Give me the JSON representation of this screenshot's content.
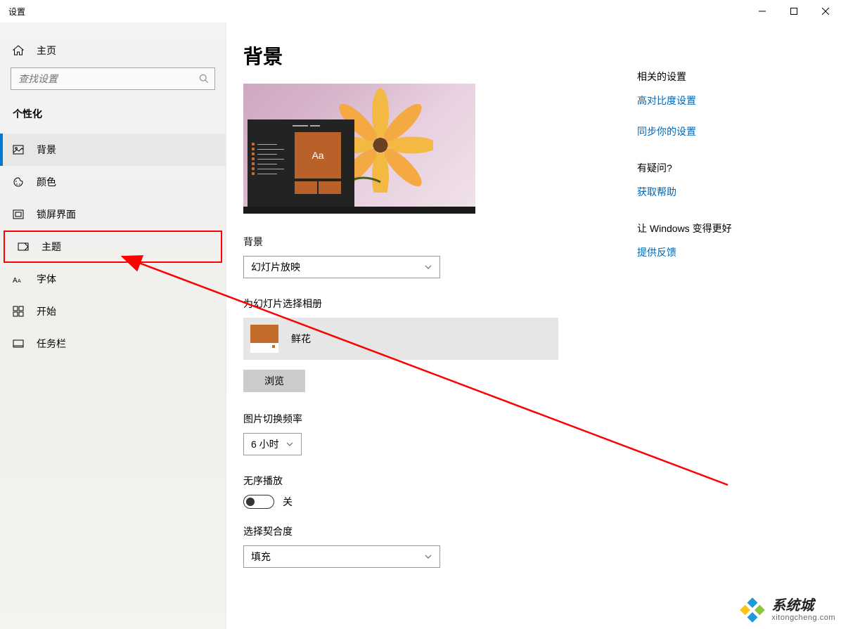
{
  "window": {
    "title": "设置"
  },
  "sidebar": {
    "home": "主页",
    "search_placeholder": "查找设置",
    "section": "个性化",
    "items": [
      {
        "label": "背景"
      },
      {
        "label": "颜色"
      },
      {
        "label": "锁屏界面"
      },
      {
        "label": "主题"
      },
      {
        "label": "字体"
      },
      {
        "label": "开始"
      },
      {
        "label": "任务栏"
      }
    ]
  },
  "page": {
    "title": "背景",
    "preview_tile_text": "Aa",
    "bg_label": "背景",
    "bg_dropdown": "幻灯片放映",
    "album_label": "为幻灯片选择相册",
    "album_name": "鲜花",
    "browse": "浏览",
    "freq_label": "图片切换频率",
    "freq_value": "6 小时",
    "shuffle_label": "无序播放",
    "shuffle_state": "关",
    "fit_label": "选择契合度",
    "fit_value": "填充"
  },
  "rail": {
    "related_title": "相关的设置",
    "related_links": [
      "高对比度设置",
      "同步你的设置"
    ],
    "question_title": "有疑问?",
    "help_link": "获取帮助",
    "feedback_title": "让 Windows 变得更好",
    "feedback_link": "提供反馈"
  },
  "watermark": {
    "name": "系统城",
    "url": "xitongcheng.com"
  }
}
